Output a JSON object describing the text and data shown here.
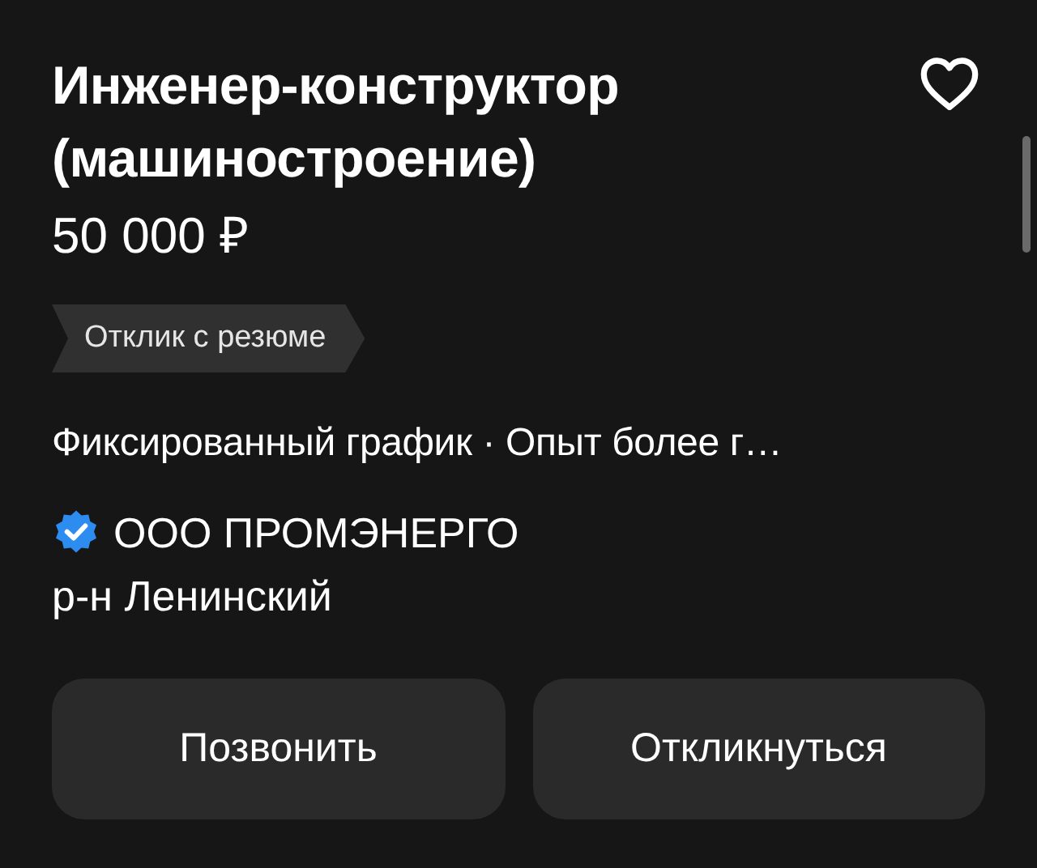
{
  "vacancy": {
    "title": "Инженер-конструктор (машиностроение)",
    "favorite": false,
    "salary": "50 000 ₽",
    "tag": "Отклик с резюме",
    "details": "Фиксированный график · Опыт более г…",
    "company": {
      "name": "ООО ПРОМЭНЕРГО",
      "verified": true
    },
    "district": "р-н Ленинский"
  },
  "buttons": [
    {
      "label": "Позвонить"
    },
    {
      "label": "Откликнуться"
    }
  ]
}
